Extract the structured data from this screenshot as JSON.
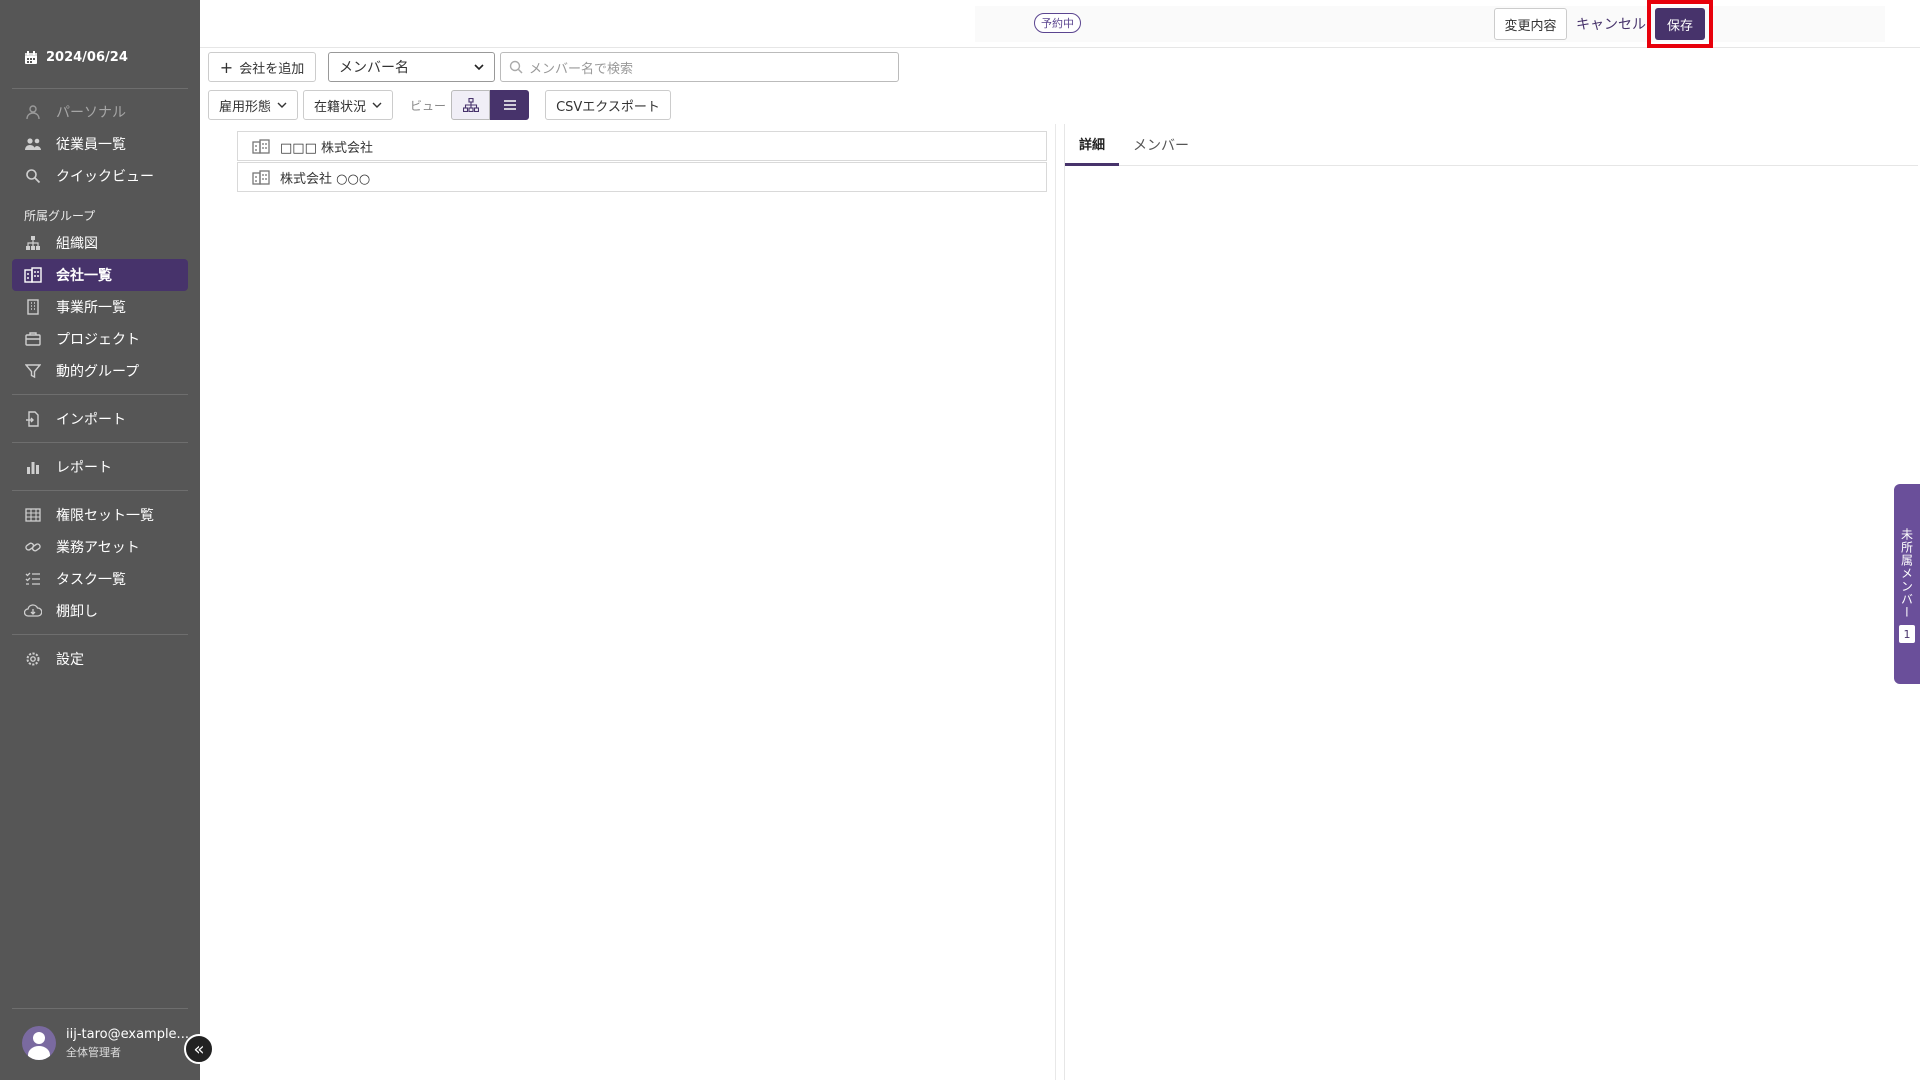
{
  "sidebar": {
    "date": "2024/06/24",
    "items": [
      {
        "label": "パーソナル",
        "icon": "person-icon",
        "state": "muted"
      },
      {
        "label": "従業員一覧",
        "icon": "people-icon"
      },
      {
        "label": "クイックビュー",
        "icon": "search-icon"
      }
    ],
    "section_label": "所属グループ",
    "group_items": [
      {
        "label": "組織図",
        "icon": "org-chart-icon"
      },
      {
        "label": "会社一覧",
        "icon": "company-icon",
        "state": "active"
      },
      {
        "label": "事業所一覧",
        "icon": "building-icon"
      },
      {
        "label": "プロジェクト",
        "icon": "briefcase-icon"
      },
      {
        "label": "動的グループ",
        "icon": "filter-icon"
      }
    ],
    "import_label": "インポート",
    "report_label": "レポート",
    "admin_items": [
      {
        "label": "権限セット一覧",
        "icon": "table-icon"
      },
      {
        "label": "業務アセット",
        "icon": "link-icon"
      },
      {
        "label": "タスク一覧",
        "icon": "task-list-icon"
      },
      {
        "label": "棚卸し",
        "icon": "cloud-download-icon"
      }
    ],
    "settings_label": "設定",
    "user": {
      "email": "iij-taro@example...",
      "role": "全体管理者"
    }
  },
  "topbar": {
    "badge": "予約中",
    "changes_label": "変更内容",
    "cancel_label": "キャンセル",
    "save_label": "保存"
  },
  "toolbar": {
    "add_company_label": "会社を追加",
    "search_field_select": "メンバー名",
    "search_placeholder": "メンバー名で検索",
    "employment_type_label": "雇用形態",
    "status_label": "在籍状況",
    "view_label": "ビュー",
    "csv_export_label": "CSVエクスポート"
  },
  "companies": [
    {
      "name": "□□□ 株式会社"
    },
    {
      "name": "株式会社 ○○○"
    }
  ],
  "detail": {
    "tabs": [
      {
        "label": "詳細",
        "active": true
      },
      {
        "label": "メンバー"
      }
    ]
  },
  "unassigned": {
    "label": "未所属メンバー",
    "count": "1"
  },
  "colors": {
    "accent": "#47336b",
    "sidebar_bg": "#565656",
    "highlight": "#e8000b"
  }
}
